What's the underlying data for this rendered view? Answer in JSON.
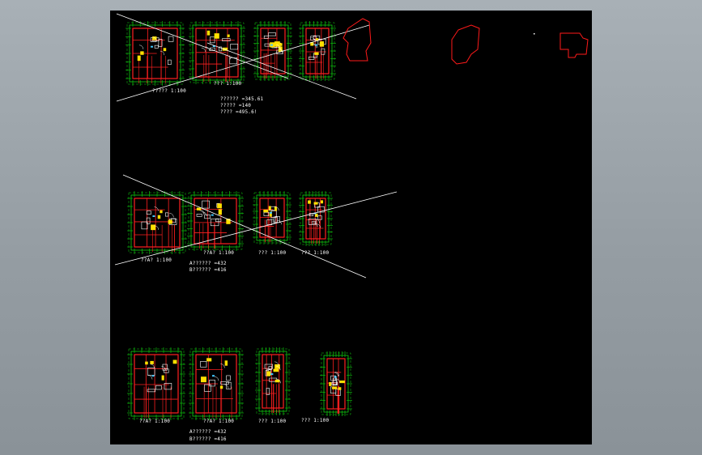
{
  "app": {
    "canvas_bg": "#000000",
    "window_bg": "#9aa2a8"
  },
  "colors": {
    "wall": "#ff2020",
    "dimension": "#10d010",
    "fixture": "#ffe000",
    "furniture": "#ffffff",
    "accent": "#40c8ff",
    "cross_line": "#ffffff",
    "outline": "#ff1a1a"
  },
  "rows": [
    {
      "captions": [
        "?????  1:100",
        "???  1:100",
        "",
        ""
      ],
      "area_lines": [
        "?????? =345.61",
        "????? =140",
        "???? =495.6!"
      ],
      "crossed": true
    },
    {
      "captions": [
        "??A?  1:100",
        "??A?  1:100",
        "???  1:100",
        "???  1:100"
      ],
      "area_lines": [
        "A?????? =432",
        "B?????? =416"
      ],
      "crossed": true
    },
    {
      "captions": [
        "??A?  1:100",
        "??A?  1:100",
        "???  1:100",
        "???  1:100"
      ],
      "area_lines": [
        "A?????? =432",
        "B?????? =416"
      ],
      "crossed": false
    }
  ],
  "site_outlines": [
    "outline-a",
    "outline-b",
    "outline-c"
  ]
}
